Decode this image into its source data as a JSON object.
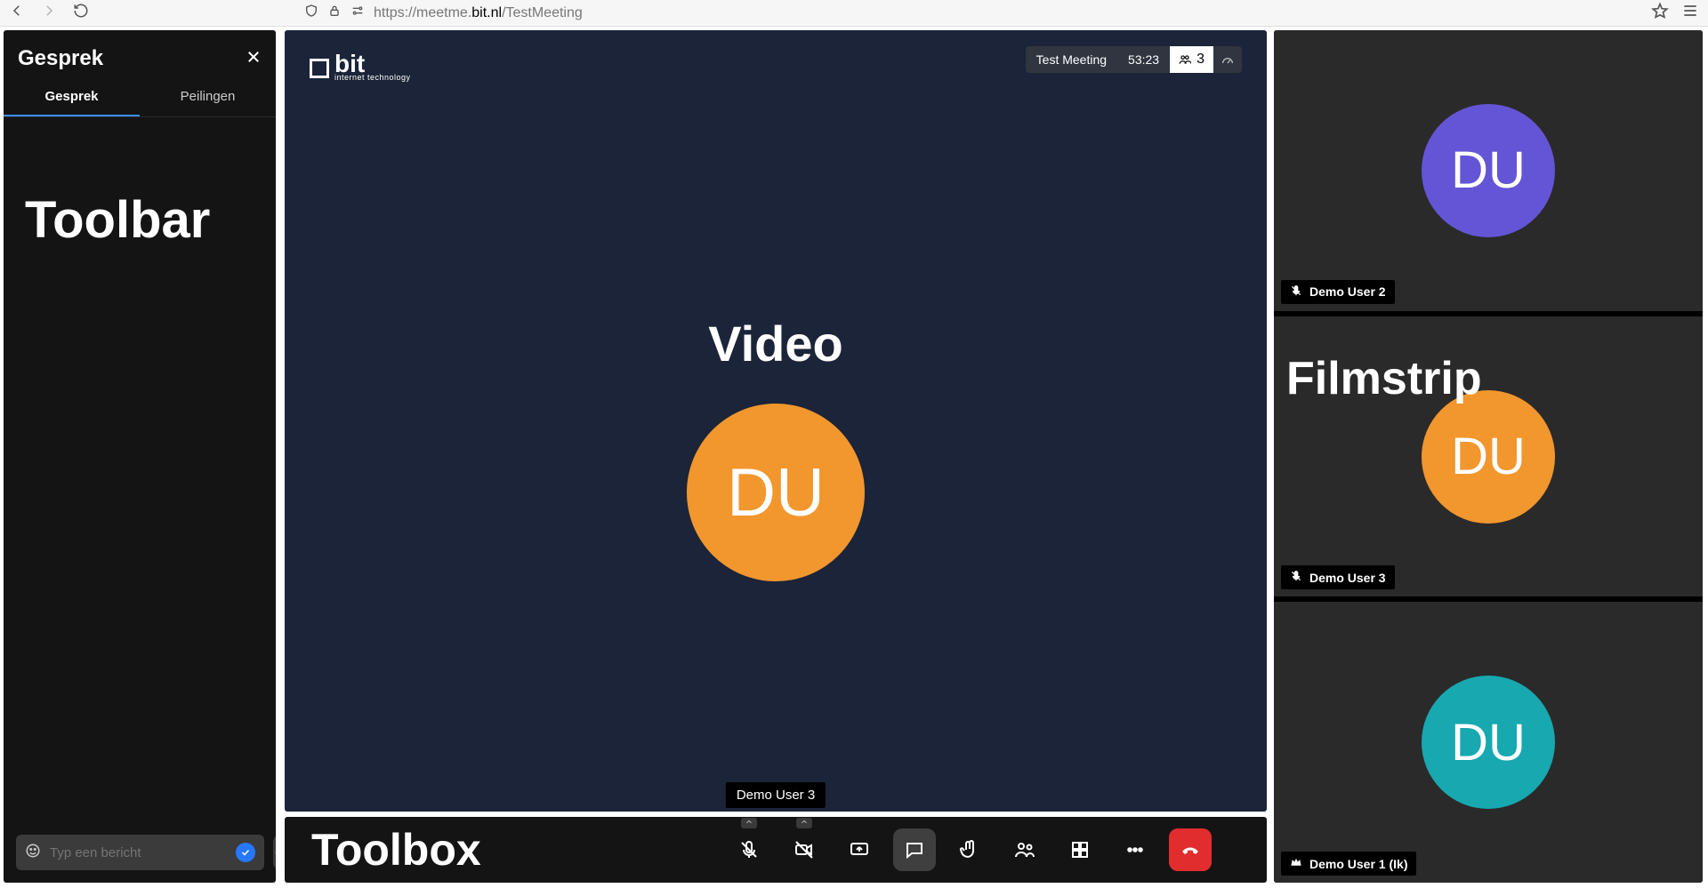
{
  "browser": {
    "url_prefix": "https://meetme.",
    "url_domain": "bit.nl",
    "url_path": "/TestMeeting"
  },
  "chat": {
    "title": "Gesprek",
    "tabs": {
      "chat": "Gesprek",
      "polls": "Peilingen"
    },
    "input_placeholder": "Typ een bericht",
    "overlay_label": "Toolbar"
  },
  "meeting": {
    "logo_text": "bit",
    "logo_subtext": "internet technology",
    "name": "Test Meeting",
    "duration": "53:23",
    "participants_count": "3"
  },
  "stage": {
    "overlay_label": "Video",
    "avatar_initials": "DU",
    "avatar_color": "#f2962e",
    "speaker_name": "Demo User 3"
  },
  "toolbox": {
    "overlay_label": "Toolbox"
  },
  "filmstrip": {
    "overlay_label": "Filmstrip",
    "tiles": [
      {
        "initials": "DU",
        "color": "#6455d6",
        "name": "Demo User 2",
        "muted": true,
        "moderator": false
      },
      {
        "initials": "DU",
        "color": "#f2962e",
        "name": "Demo User 3",
        "muted": true,
        "moderator": false
      },
      {
        "initials": "DU",
        "color": "#17a8b0",
        "name": "Demo User 1 (Ik)",
        "muted": true,
        "moderator": true
      }
    ]
  }
}
